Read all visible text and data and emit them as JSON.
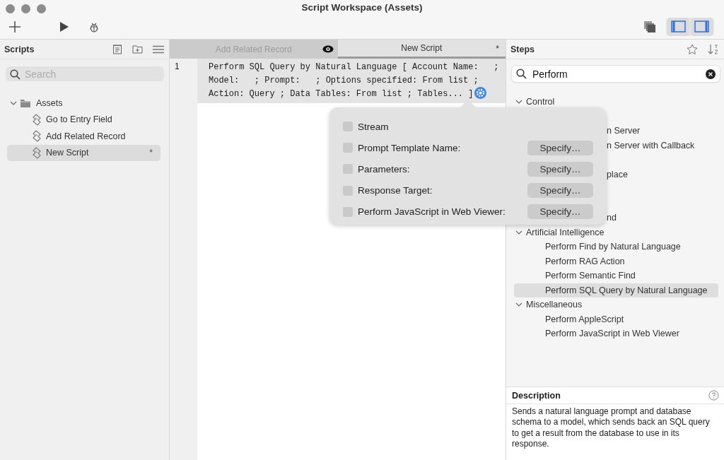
{
  "window": {
    "title": "Script Workspace (Assets)"
  },
  "scripts_pane": {
    "title": "Scripts",
    "search": {
      "placeholder": "Search"
    },
    "tree": [
      {
        "label": "Assets",
        "kind": "folder",
        "expanded": true,
        "selected": false,
        "children": [
          {
            "label": "Go to Entry Field",
            "kind": "script",
            "selected": false
          },
          {
            "label": "Add Related Record",
            "kind": "script",
            "selected": false
          },
          {
            "label": "New Script",
            "kind": "script",
            "selected": true,
            "mark": "*"
          }
        ]
      }
    ]
  },
  "editor": {
    "tabs": [
      {
        "label": "Add Related Record",
        "selected": false
      },
      {
        "label": "New Script",
        "selected": true,
        "mark": "*"
      }
    ],
    "lines": [
      {
        "number": "1",
        "text": "Perform SQL Query by Natural Language [ Account Name:   ;\nModel:   ; Prompt:   ; Options specified: From list ;\nAction: Query ; Data Tables: From list ; Tables... ]"
      }
    ]
  },
  "popover": {
    "options": [
      {
        "label": "Stream",
        "checked": false
      },
      {
        "label": "Prompt Template Name:",
        "checked": false,
        "button": "Specify…"
      },
      {
        "label": "Parameters:",
        "checked": false,
        "button": "Specify…"
      },
      {
        "label": "Response Target:",
        "checked": false,
        "button": "Specify…"
      },
      {
        "label": "Perform JavaScript in Web Viewer:",
        "checked": false,
        "button": "Specify…"
      }
    ]
  },
  "steps_pane": {
    "title": "Steps",
    "search": {
      "value": "Perform"
    },
    "groups": [
      {
        "label": "Control",
        "expanded": true,
        "children": [
          {
            "label": "n Server",
            "kind": "covered",
            "selected": false
          },
          {
            "label": "n Server with Callback",
            "kind": "covered",
            "selected": false
          },
          {
            "label": "place",
            "kind": "covered",
            "selected": false
          },
          {
            "label": "nd",
            "kind": "covered",
            "selected": false
          }
        ]
      },
      {
        "label": "Artificial Intelligence",
        "expanded": true,
        "children": [
          {
            "label": "Perform Find by Natural Language",
            "kind": "step",
            "selected": false
          },
          {
            "label": "Perform RAG Action",
            "kind": "step",
            "selected": false
          },
          {
            "label": "Perform Semantic Find",
            "kind": "step",
            "selected": false
          },
          {
            "label": "Perform SQL Query by Natural Language",
            "kind": "step",
            "selected": true
          }
        ]
      },
      {
        "label": "Miscellaneous",
        "expanded": true,
        "children": [
          {
            "label": "Perform AppleScript",
            "kind": "step",
            "selected": false
          },
          {
            "label": "Perform JavaScript in Web Viewer",
            "kind": "step",
            "selected": false
          }
        ]
      }
    ]
  },
  "description": {
    "title": "Description",
    "text": "Sends a natural language prompt and database schema to a model, which sends back an SQL query to get a result from the database to use in its response."
  }
}
